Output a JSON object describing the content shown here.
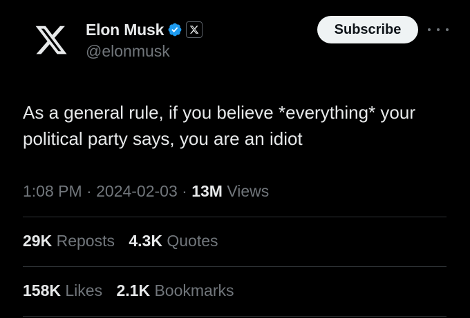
{
  "tweet": {
    "author_name": "Elon Musk",
    "handle": "@elonmusk",
    "subscribe_label": "Subscribe",
    "text": "As a general rule, if you believe *everything* your political party says, you are an idiot",
    "time": "1:08 PM",
    "date": "2024-02-03",
    "views_count": "13M",
    "views_label": "Views",
    "separator": "·"
  },
  "stats": {
    "reposts_count": "29K",
    "reposts_label": "Reposts",
    "quotes_count": "4.3K",
    "quotes_label": "Quotes",
    "likes_count": "158K",
    "likes_label": "Likes",
    "bookmarks_count": "2.1K",
    "bookmarks_label": "Bookmarks"
  },
  "colors": {
    "background": "#000000",
    "text_primary": "#e7e9ea",
    "text_secondary": "#71767b",
    "verified_blue": "#1d9bf0",
    "divider": "#2f3336"
  },
  "icons": {
    "avatar": "x-logo-icon",
    "verified": "verified-badge-icon",
    "affiliation": "x-affiliation-icon",
    "more": "more-dots-icon"
  }
}
